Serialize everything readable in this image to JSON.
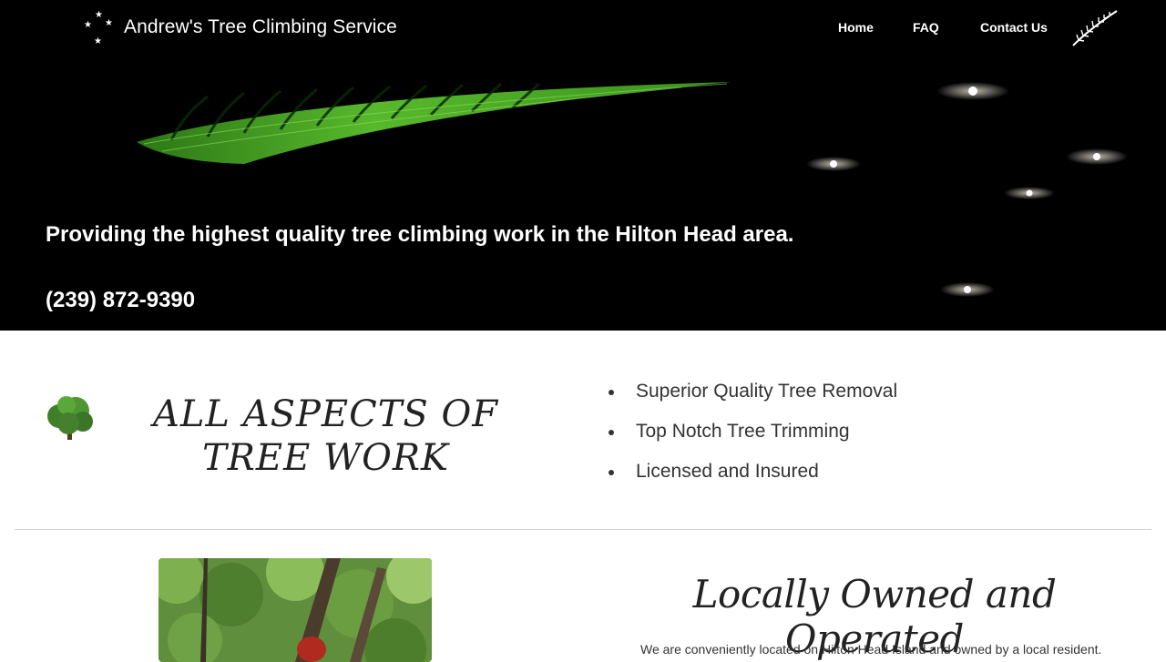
{
  "brand": {
    "title": "Andrew's Tree Climbing Service"
  },
  "nav": {
    "items": [
      {
        "label": "Home"
      },
      {
        "label": "FAQ"
      },
      {
        "label": "Contact Us"
      }
    ]
  },
  "hero": {
    "tagline": "Providing the highest quality tree climbing work in the Hilton Head area.",
    "phone": "(239) 872-9390"
  },
  "services_section": {
    "title": "ALL ASPECTS OF TREE WORK",
    "items": [
      {
        "label": "Superior Quality Tree Removal"
      },
      {
        "label": "Top Notch Tree Trimming"
      },
      {
        "label": "Licensed and Insured"
      }
    ]
  },
  "local_section": {
    "title": "Locally Owned and Operated",
    "text": "We are conveniently located on Hilton Head Island and owned by a local resident."
  },
  "colors": {
    "hero_bg": "#000000",
    "fern_green": "#4caf2a",
    "text_dark": "#333333",
    "divider": "#d4d4d4"
  }
}
